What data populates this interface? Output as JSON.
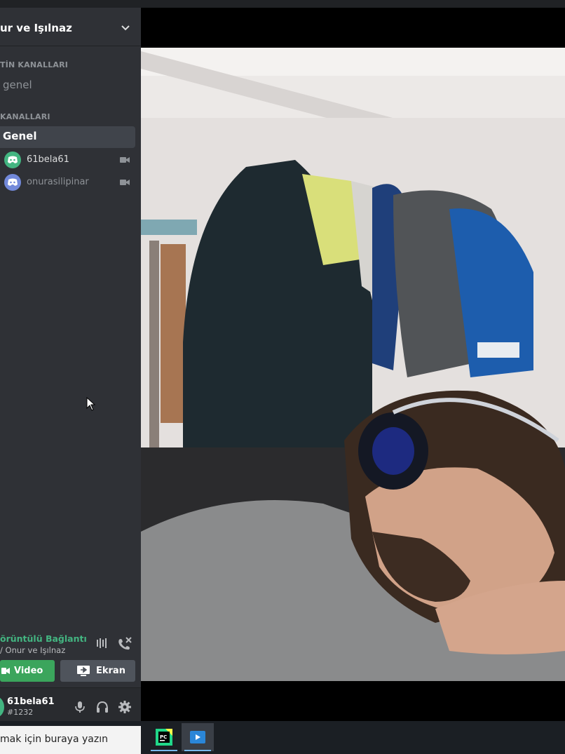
{
  "server": {
    "name": "ur ve Işılnaz"
  },
  "categories": {
    "text": "TİN KANALLARI",
    "voice": "KANALLARI"
  },
  "text_channels": [
    {
      "name": "genel"
    }
  ],
  "voice_channel": {
    "name": "Genel"
  },
  "voice_users": [
    {
      "name": "61bela61",
      "color": "#dcddde",
      "avatar_color": "#43b581"
    },
    {
      "name": "onurasilipinar",
      "color": "#8e9297",
      "avatar_color": "#7289da"
    }
  ],
  "voice_panel": {
    "status": "örüntülü Bağlantı Ku",
    "location": "/ Onur ve Işılnaz",
    "video_label": "Video",
    "screen_label": "Ekran"
  },
  "user": {
    "name": "61bela61",
    "tag": "#1232"
  },
  "taskbar": {
    "search_placeholder": "mak için buraya yazın",
    "apps": [
      {
        "name": "PyCharm",
        "icon": "pycharm-icon"
      },
      {
        "name": "Media Player",
        "icon": "media-player-icon"
      }
    ]
  },
  "colors": {
    "sidebar_bg": "#2f3136",
    "active_channel_bg": "#40444b",
    "connected_green": "#43b581",
    "video_button": "#3ba55c",
    "screen_button": "#4f545c",
    "user_panel_bg": "#292b2f"
  }
}
